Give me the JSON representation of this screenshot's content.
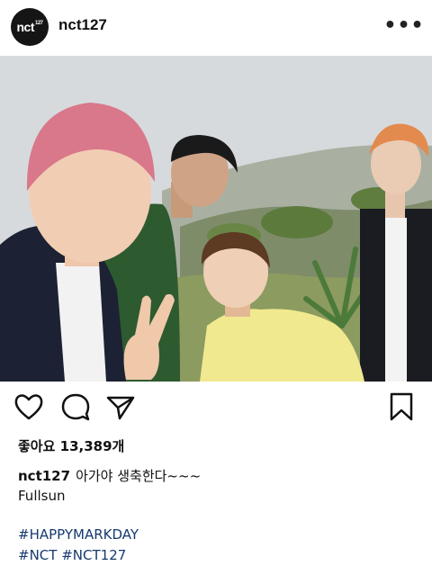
{
  "header": {
    "avatar_text": "nct",
    "avatar_sup": "127",
    "username": "nct127",
    "more_label": "•••"
  },
  "post": {
    "likes_label": "좋아요",
    "likes_count": "13,389개",
    "caption_user": "nct127",
    "caption_text": "아가야 생축한다~~~",
    "caption_line2": "Fullsun",
    "hashtag1": "#HAPPYMARKDAY",
    "hashtag2": "#NCT",
    "hashtag3": "#NCT127"
  },
  "icons": {
    "like": "heart-icon",
    "comment": "comment-icon",
    "share": "share-icon",
    "save": "bookmark-icon"
  },
  "colors": {
    "hashtag": "#163a6e",
    "avatar_bg": "#151515"
  }
}
